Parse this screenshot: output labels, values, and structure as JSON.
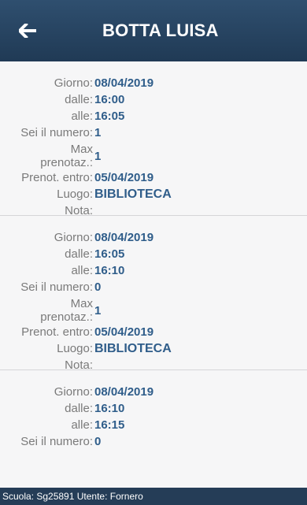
{
  "header": {
    "title": "BOTTA LUISA"
  },
  "labels": {
    "giorno": "Giorno:",
    "dalle": "dalle:",
    "alle": "alle:",
    "numero": "Sei il numero:",
    "max_line1": "Max",
    "max_line2": "prenotaz.:",
    "entro": "Prenot. entro:",
    "luogo": "Luogo:",
    "nota": "Nota:"
  },
  "appointments": [
    {
      "giorno": "08/04/2019",
      "dalle": "16:00",
      "alle": "16:05",
      "numero": "1",
      "max": "1",
      "entro": "05/04/2019",
      "luogo": "BIBLIOTECA",
      "nota": ""
    },
    {
      "giorno": "08/04/2019",
      "dalle": "16:05",
      "alle": "16:10",
      "numero": "0",
      "max": "1",
      "entro": "05/04/2019",
      "luogo": "BIBLIOTECA",
      "nota": ""
    },
    {
      "giorno": "08/04/2019",
      "dalle": "16:10",
      "alle": "16:15",
      "numero": "0"
    }
  ],
  "footer": {
    "text": "Scuola: Sg25891 Utente: Fornero"
  }
}
